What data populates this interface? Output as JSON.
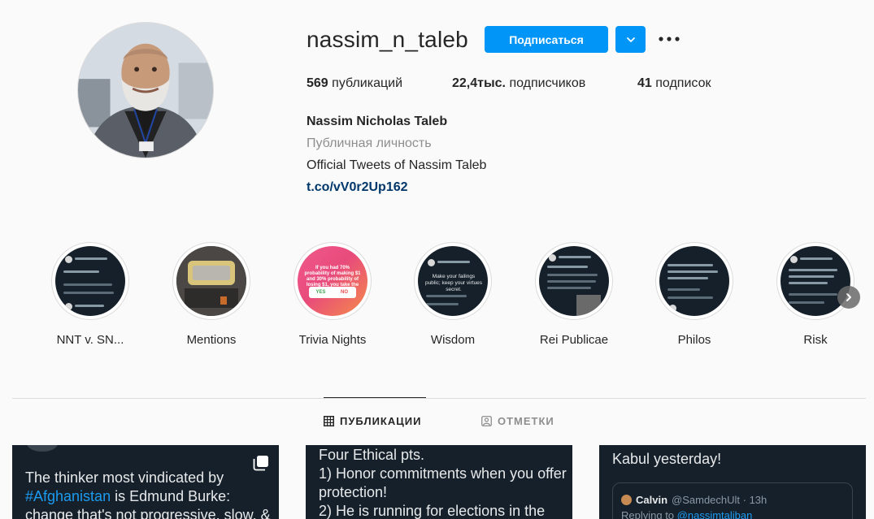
{
  "profile": {
    "username": "nassim_n_taleb",
    "follow_label": "Подписаться",
    "full_name": "Nassim Nicholas Taleb",
    "category": "Публичная личность",
    "bio": "Official Tweets of Nassim Taleb",
    "link": "t.co/vV0r2Up162"
  },
  "stats": {
    "posts_count": "569",
    "posts_label": "публикаций",
    "followers_count": "22,4тыс.",
    "followers_label": "подписчиков",
    "following_count": "41",
    "following_label": "подписок"
  },
  "highlights": [
    {
      "label": "NNT v. SN..."
    },
    {
      "label": "Mentions"
    },
    {
      "label": "Trivia Nights"
    },
    {
      "label": "Wisdom"
    },
    {
      "label": "Rei Publicae"
    },
    {
      "label": "Philos"
    },
    {
      "label": "Risk"
    }
  ],
  "highlight_thumbs": {
    "trivia_text": "If you had 70% probability of making $1 and 30% probability of losing $1, you take the bet?",
    "trivia_yes": "YES",
    "trivia_no": "NO",
    "wisdom_text": "Make your failings public; keep your virtues secret."
  },
  "tabs": {
    "posts": "ПУБЛИКАЦИИ",
    "tagged": "ОТМЕТКИ"
  },
  "posts": [
    {
      "text_1": "The thinker most vindicated by",
      "hashtag": "#Afghanistan",
      "text_2": " is Edmund Burke:",
      "text_3": "change that's not progressive, slow, &"
    },
    {
      "text_1": "Four Ethical pts.",
      "text_2": "1) Honor commitments when you offer",
      "text_3": "protection!",
      "text_4": "2) He is running for elections in the"
    },
    {
      "text_1": "Kabul yesterday!",
      "quote_name": "Calvin",
      "quote_handle": "@SamdechUlt · 13h",
      "quote_reply_prefix": "Replying to ",
      "quote_reply_handle": "@nassimtaliban"
    }
  ],
  "icons": [
    "chevron-down-icon",
    "more-icon",
    "grid-icon",
    "tagged-icon",
    "chevron-right-icon",
    "multiple-posts-icon"
  ],
  "colors": {
    "accent": "#0095f6",
    "link": "#00376b",
    "twitter_bg": "#15202b",
    "twitter_blue": "#1d9bf0"
  }
}
